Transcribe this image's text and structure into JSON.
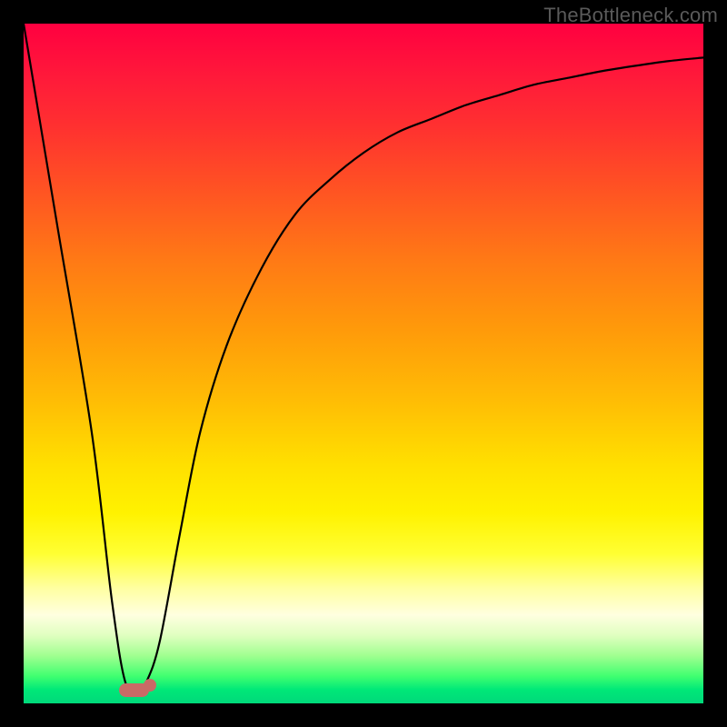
{
  "watermark": "TheBottleneck.com",
  "colors": {
    "frame": "#000000",
    "marker": "#c96a66",
    "curve": "#000000"
  },
  "chart_data": {
    "type": "line",
    "title": "",
    "xlabel": "",
    "ylabel": "",
    "xlim": [
      0,
      100
    ],
    "ylim": [
      0,
      100
    ],
    "grid": false,
    "background": "vertical gradient red→yellow→green (bottleneck heat)",
    "series": [
      {
        "name": "bottleneck-curve",
        "x": [
          0,
          5,
          10,
          13,
          15,
          17,
          18,
          20,
          23,
          26,
          30,
          35,
          40,
          45,
          50,
          55,
          60,
          65,
          70,
          75,
          80,
          85,
          90,
          95,
          100
        ],
        "values": [
          100,
          70,
          40,
          15,
          3,
          2,
          3,
          9,
          25,
          40,
          53,
          64,
          72,
          77,
          81,
          84,
          86,
          88,
          89.5,
          91,
          92,
          93,
          93.8,
          94.5,
          95
        ]
      }
    ],
    "optimum_marker": {
      "x_start": 14,
      "x_end": 18.5,
      "y": 2
    }
  }
}
